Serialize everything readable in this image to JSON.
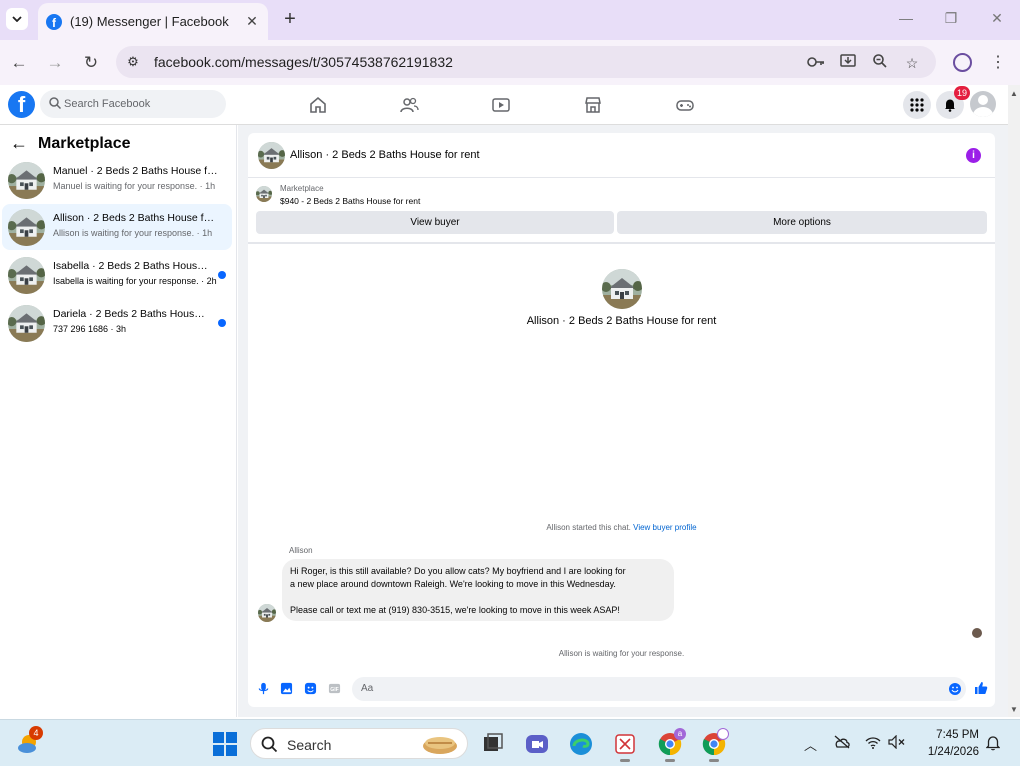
{
  "browser": {
    "tab_title": "(19) Messenger | Facebook",
    "url": "facebook.com/messages/t/30574538762191832"
  },
  "facebook": {
    "search_placeholder": "Search Facebook",
    "notification_count": "19"
  },
  "sidebar": {
    "title": "Marketplace",
    "conversations": [
      {
        "name": "Manuel · 2 Beds 2 Baths House for rent",
        "preview": "Manuel is waiting for your response. · 1h",
        "unread": false,
        "active": false
      },
      {
        "name": "Allison · 2 Beds 2 Baths House for rent",
        "preview": "Allison is waiting for your response. · 1h",
        "unread": false,
        "active": true
      },
      {
        "name": "Isabella · 2 Beds 2 Baths House for rent",
        "preview": "Isabella is waiting for your response. · 2h",
        "unread": true,
        "active": false
      },
      {
        "name": "Dariela · 2 Beds 2 Baths House for rent",
        "preview": "737 296 1686 · 3h",
        "unread": true,
        "active": false
      }
    ]
  },
  "chat": {
    "header_name": "Allison · 2 Beds 2 Baths House for rent",
    "listing_label": "Marketplace",
    "listing_price": "$940 - 2 Beds 2 Baths House for rent",
    "view_buyer_label": "View buyer",
    "more_options_label": "More options",
    "center_name": "Allison · 2 Beds 2 Baths House for rent",
    "started_text": "Allison started this chat.",
    "view_profile_link": "View buyer profile",
    "sender_name": "Allison",
    "message_line1": "Hi Roger, is this still available? Do you allow cats? My boyfriend and I are looking for",
    "message_line2": "a new place around downtown Raleigh. We're looking to move in this Wednesday.",
    "message_line3": "Please call or text me at (919) 830-3515, we're looking to move in this week ASAP!",
    "waiting_text": "Allison is waiting for your response.",
    "composer_placeholder": "Aa"
  },
  "taskbar": {
    "weather_badge": "4",
    "search_placeholder": "Search",
    "chrome_profile_badge": "a",
    "time": "7:45 PM",
    "date": "1/24/2026"
  },
  "colors": {
    "fb_blue": "#1877f2",
    "link_blue": "#0064d1",
    "unread_dot": "#0866ff",
    "info_purple": "#9b1fe8",
    "badge_red": "#e41e3f"
  }
}
